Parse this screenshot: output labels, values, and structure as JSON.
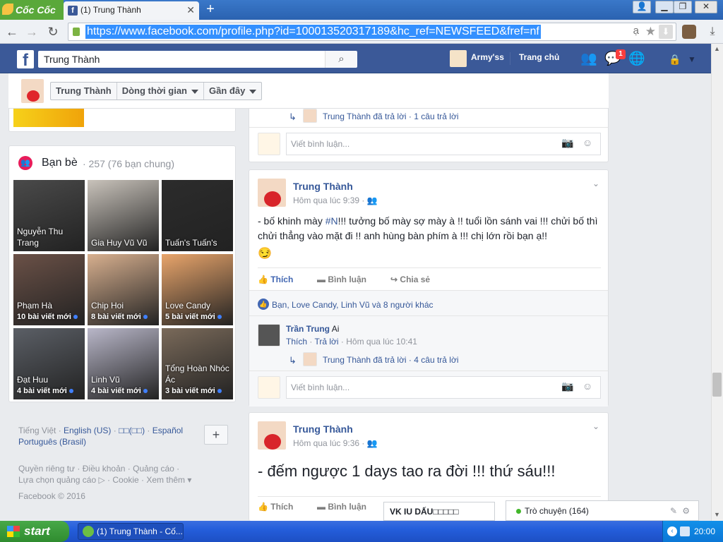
{
  "browser": {
    "brand": "Cốc Cốc",
    "tab_title": "(1) Trung Thành",
    "url": "https://www.facebook.com/profile.php?id=100013520317189&hc_ref=NEWSFEED&fref=nf",
    "translate_glyph": "ạ"
  },
  "fb": {
    "search_value": "Trung Thành",
    "profile_name": "Army'ss",
    "home_label": "Trang chủ",
    "notif_count": "1"
  },
  "timeline": {
    "crumbs": [
      "Trung Thành",
      "Dòng thời gian",
      "Gần đây"
    ]
  },
  "friends": {
    "title": "Bạn bè",
    "count": "· 257 (76 bạn chung)",
    "items": [
      {
        "name": "Nguyễn Thu Trang",
        "sub": "",
        "color": "#4a4a4a"
      },
      {
        "name": "Gia Huy Vũ Vũ",
        "sub": "",
        "color": "#c9c3bb"
      },
      {
        "name": "Tuấn's Tuấn's",
        "sub": "",
        "color": "#2c2c2c"
      },
      {
        "name": "Phạm Hà",
        "sub": "10 bài viết mới",
        "color": "#6b5147"
      },
      {
        "name": "Chip Hoi",
        "sub": "8 bài viết mới",
        "color": "#d8b08f"
      },
      {
        "name": "Love Candy",
        "sub": "5 bài viết mới",
        "color": "#e9a56b"
      },
      {
        "name": "Đạt Huu",
        "sub": "4 bài viết mới",
        "color": "#5b5f66"
      },
      {
        "name": "Linh Vũ",
        "sub": "4 bài viết mới",
        "color": "#b9b7c9"
      },
      {
        "name": "Tổng Hoàn Nhóc Ác",
        "sub": "3 bài viết mới",
        "color": "#7a6a5a"
      }
    ]
  },
  "footer": {
    "lang_current": "Tiếng Việt",
    "lang_links": [
      "English (US)",
      "□□(□□)",
      "Español",
      "Português (Brasil)"
    ],
    "links1": "Quyền riêng tư · Điều khoản · Quảng cáo ·",
    "links2": "Lựa chọn quảng cáo ▷ · Cookie · Xem thêm ▾",
    "copyright": "Facebook © 2016"
  },
  "post0": {
    "reply_line": "Trung Thành đã trả lời · 1 câu trả lời",
    "comment_placeholder": "Viết bình luận..."
  },
  "post1": {
    "author": "Trung Thành",
    "time": "Hôm qua lúc 9:39 ·",
    "text": "- bố khinh mày #N!!! tưởng bố mày sợ mày à !! tuổi lồn sánh vai !!! chửi bố thì chửi thẳng vào mặt đi !! anh hùng bàn phím à !!! chị lớn rồi bạn ạ!!",
    "hashtag": "#N",
    "emoji": "😏",
    "like": "Thích",
    "comment": "Bình luận",
    "share": "Chia sẻ",
    "likes_line": "Bạn, Love Candy, Linh Vũ và 8 người khác",
    "commenter": "Trần Trung",
    "comment_text": "Ai",
    "c_like": "Thích",
    "c_reply": "Trả lời",
    "c_time": "· Hôm qua lúc 10:41",
    "reply_line": "Trung Thành đã trả lời · 4 câu trả lời",
    "comment_placeholder": "Viết bình luận..."
  },
  "post2": {
    "author": "Trung Thành",
    "time": "Hôm qua lúc 9:36 ·",
    "text": "- đếm ngược 1 days tao ra đời !!! thứ sáu!!!",
    "like": "Thích",
    "comment": "Bình luận"
  },
  "chat": {
    "box_title": "VK IU DẤU□□□□□",
    "sidebar_label": "Trò chuyện (164)"
  },
  "taskbar": {
    "start": "start",
    "app": "(1) Trung Thành - Cố...",
    "clock": "20:00"
  }
}
